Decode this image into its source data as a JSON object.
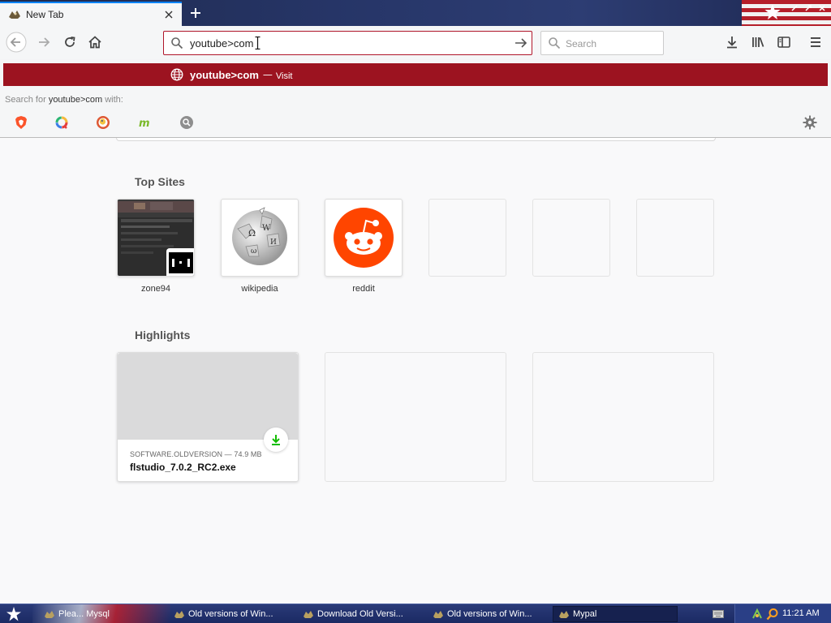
{
  "tab": {
    "title": "New Tab"
  },
  "urlbar": {
    "value": "youtube>com"
  },
  "searchbar": {
    "placeholder": "Search"
  },
  "suggestion": {
    "title": "youtube>com",
    "separator": "—",
    "action": "Visit"
  },
  "search_with": {
    "prefix": "Search for",
    "query": "youtube>com",
    "suffix": "with:"
  },
  "search_engines": [
    "brave-icon",
    "qwant-icon",
    "duckduckgo-icon",
    "mojeek-icon",
    "generic-search-icon"
  ],
  "top_sites": {
    "heading": "Top Sites",
    "items": [
      {
        "label": "zone94"
      },
      {
        "label": "wikipedia"
      },
      {
        "label": "reddit"
      },
      {
        "label": ""
      },
      {
        "label": ""
      },
      {
        "label": ""
      }
    ]
  },
  "highlights": {
    "heading": "Highlights",
    "items": [
      {
        "source": "SOFTWARE.OLDVERSION — 74.9 MB",
        "filename": "flstudio_7.0.2_RC2.exe"
      }
    ]
  },
  "taskbar": {
    "items": [
      {
        "label": "Plea... Mysql"
      },
      {
        "label": "Old versions of Win..."
      },
      {
        "label": "Download Old Versi..."
      },
      {
        "label": "Old versions of Win..."
      },
      {
        "label": "Mypal"
      }
    ],
    "clock": "11:21 AM"
  },
  "colors": {
    "accent": "#9c1320",
    "focus_border": "#b0152a",
    "reddit": "#ff4500",
    "download_green": "#12bc00"
  }
}
